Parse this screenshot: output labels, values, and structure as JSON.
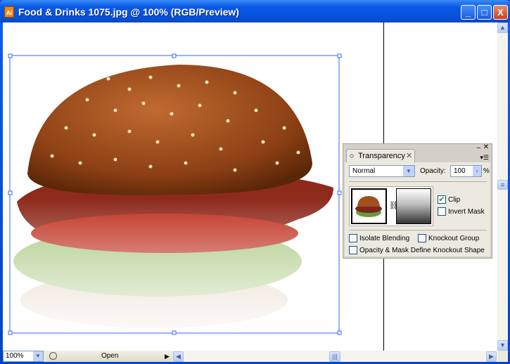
{
  "window": {
    "title": "Food & Drinks 1075.jpg @ 100% (RGB/Preview)",
    "app_icon": "Ai",
    "minimize": "_",
    "maximize": "□",
    "close": "X"
  },
  "status": {
    "zoom": "100%",
    "status_label": "Open"
  },
  "panel": {
    "tab": "Transparency",
    "blend_mode": "Normal",
    "opacity_label": "Opacity:",
    "opacity_value": "100",
    "percent": "%",
    "clip_label": "Clip",
    "clip_checked": true,
    "invert_label": "Invert Mask",
    "invert_checked": false,
    "isolate_label": "Isolate Blending",
    "knockout_label": "Knockout Group",
    "define_label": "Opacity & Mask Define Knockout Shape"
  }
}
